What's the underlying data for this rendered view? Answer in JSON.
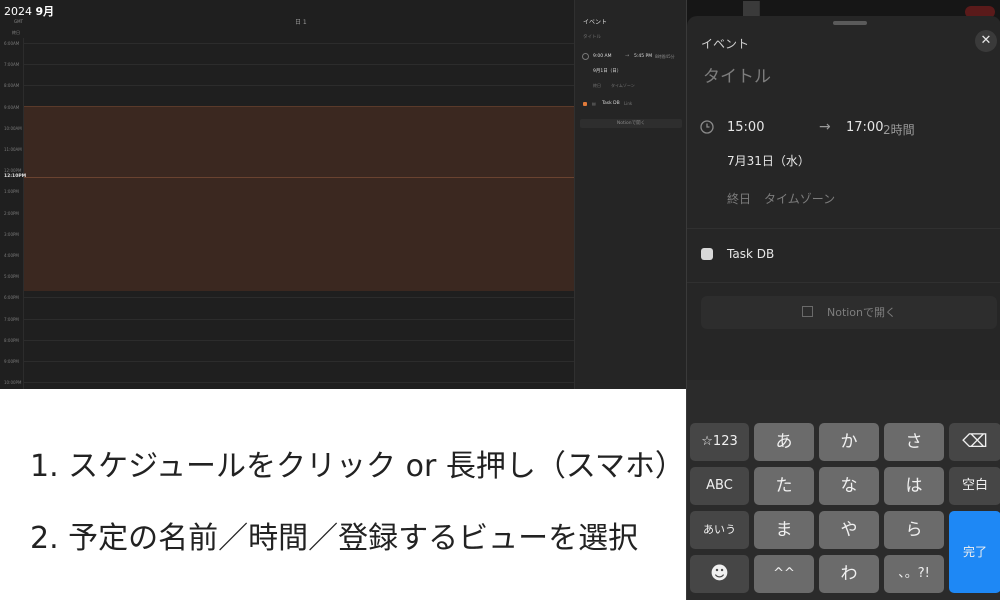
{
  "calendar": {
    "year": "2024",
    "month": "9月",
    "day_label": "日 1",
    "gmt_label": "GMT",
    "allday_label": "終日",
    "now_label": "12:10PM",
    "hours": [
      "6:00AM",
      "7:00AM",
      "8:00AM",
      "9:00AM",
      "10:00AM",
      "11:00AM",
      "12:00PM",
      "1:00PM",
      "2:00PM",
      "3:00PM",
      "4:00PM",
      "5:00PM",
      "6:00PM",
      "7:00PM",
      "8:00PM",
      "9:00PM",
      "10:00PM"
    ],
    "side": {
      "title": "イベント",
      "subtitle": "タイトル",
      "start": "9:00 AM",
      "end": "5:45 PM",
      "duration": "8時間45分",
      "date": "9月1日（日）",
      "allday": "終日",
      "timezone": "タイムゾーン",
      "db": "Task DB",
      "link": "Link",
      "open_button": "Notionで開く"
    }
  },
  "instructions": {
    "step1": "1. スケジュールをクリック or 長押し（スマホ）",
    "step2": "2. 予定の名前／時間／登録するビューを選択"
  },
  "sheet": {
    "title": "イベント",
    "title_placeholder": "タイトル",
    "start_time": "15:00",
    "arrow": "→",
    "end_time": "17:00",
    "duration": "2時間",
    "date": "7月31日（水）",
    "allday": "終日",
    "timezone": "タイムゾーン",
    "database": "Task DB",
    "open_in_notion": "Notionで開く",
    "close": "✕"
  },
  "keyboard": {
    "keys": {
      "k_123": "☆123",
      "k_a": "あ",
      "k_ka": "か",
      "k_sa": "さ",
      "k_del": "⌫",
      "k_abc": "ABC",
      "k_ta": "た",
      "k_na": "な",
      "k_ha": "は",
      "k_space": "空白",
      "k_aiu": "あいう",
      "k_ma": "ま",
      "k_ya": "や",
      "k_ra": "ら",
      "k_done": "完了",
      "k_emoji": "☻",
      "k_kaomoji": "^^",
      "k_wa": "わ",
      "k_punct": "、。?!"
    }
  },
  "colors": {
    "event_fill": "#3b2820",
    "accent_blue": "#1e88f5",
    "task_color": "#e07a3a"
  }
}
